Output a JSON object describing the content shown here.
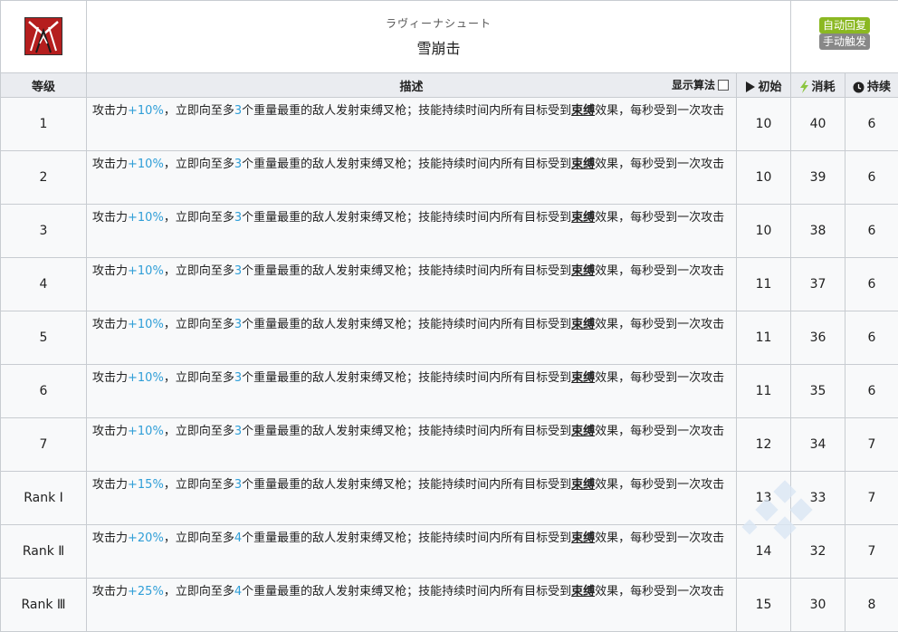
{
  "skill": {
    "icon": "snow-crash-skill-icon",
    "name_jp": "ラヴィーナシュート",
    "name_cn": "雪崩击",
    "tags": [
      "自动回复",
      "手动触发"
    ]
  },
  "columns": {
    "level": "等级",
    "description": "描述",
    "show_formula": "显示算法",
    "initial": "初始",
    "cost": "消耗",
    "duration": "持续"
  },
  "rows": [
    {
      "level": "1",
      "atk": "+10%",
      "targets": "3",
      "initial": "10",
      "cost": "40",
      "duration": "6"
    },
    {
      "level": "2",
      "atk": "+10%",
      "targets": "3",
      "initial": "10",
      "cost": "39",
      "duration": "6"
    },
    {
      "level": "3",
      "atk": "+10%",
      "targets": "3",
      "initial": "10",
      "cost": "38",
      "duration": "6"
    },
    {
      "level": "4",
      "atk": "+10%",
      "targets": "3",
      "initial": "11",
      "cost": "37",
      "duration": "6"
    },
    {
      "level": "5",
      "atk": "+10%",
      "targets": "3",
      "initial": "11",
      "cost": "36",
      "duration": "6"
    },
    {
      "level": "6",
      "atk": "+10%",
      "targets": "3",
      "initial": "11",
      "cost": "35",
      "duration": "6"
    },
    {
      "level": "7",
      "atk": "+10%",
      "targets": "3",
      "initial": "12",
      "cost": "34",
      "duration": "7"
    },
    {
      "level": "Rank Ⅰ",
      "atk": "+15%",
      "targets": "3",
      "initial": "13",
      "cost": "33",
      "duration": "7"
    },
    {
      "level": "Rank Ⅱ",
      "atk": "+20%",
      "targets": "4",
      "initial": "14",
      "cost": "32",
      "duration": "7"
    },
    {
      "level": "Rank Ⅲ",
      "atk": "+25%",
      "targets": "4",
      "initial": "15",
      "cost": "30",
      "duration": "8"
    }
  ],
  "desc_parts": {
    "p1": "攻击力",
    "p2": "，立即向至多",
    "p3": "个重量最重的敌人发射束缚叉枪；技能持续时间内所有目标受到",
    "keyword": "束缚",
    "p4": "效果，每秒受到一次攻击"
  },
  "colors": {
    "number": "#2f9ed7",
    "tag_auto": "#8bb822",
    "tag_manual": "#888888",
    "header_bg": "#eaecf0"
  }
}
